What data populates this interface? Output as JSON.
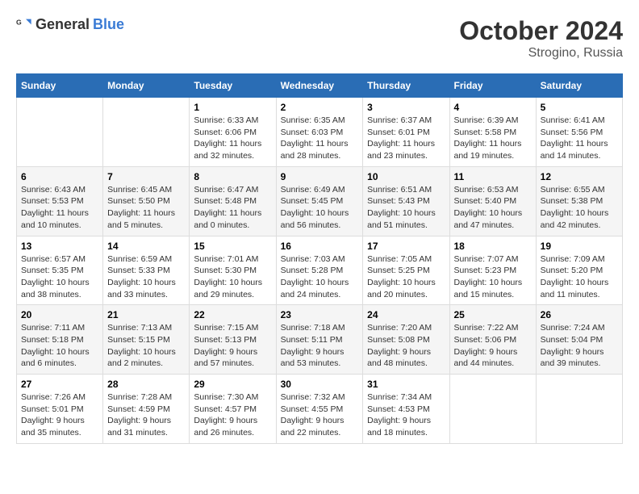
{
  "header": {
    "logo_general": "General",
    "logo_blue": "Blue",
    "month": "October 2024",
    "location": "Strogino, Russia"
  },
  "weekdays": [
    "Sunday",
    "Monday",
    "Tuesday",
    "Wednesday",
    "Thursday",
    "Friday",
    "Saturday"
  ],
  "weeks": [
    [
      null,
      null,
      {
        "day": 1,
        "sunrise": "6:33 AM",
        "sunset": "6:06 PM",
        "daylight": "11 hours and 32 minutes."
      },
      {
        "day": 2,
        "sunrise": "6:35 AM",
        "sunset": "6:03 PM",
        "daylight": "11 hours and 28 minutes."
      },
      {
        "day": 3,
        "sunrise": "6:37 AM",
        "sunset": "6:01 PM",
        "daylight": "11 hours and 23 minutes."
      },
      {
        "day": 4,
        "sunrise": "6:39 AM",
        "sunset": "5:58 PM",
        "daylight": "11 hours and 19 minutes."
      },
      {
        "day": 5,
        "sunrise": "6:41 AM",
        "sunset": "5:56 PM",
        "daylight": "11 hours and 14 minutes."
      }
    ],
    [
      {
        "day": 6,
        "sunrise": "6:43 AM",
        "sunset": "5:53 PM",
        "daylight": "11 hours and 10 minutes."
      },
      {
        "day": 7,
        "sunrise": "6:45 AM",
        "sunset": "5:50 PM",
        "daylight": "11 hours and 5 minutes."
      },
      {
        "day": 8,
        "sunrise": "6:47 AM",
        "sunset": "5:48 PM",
        "daylight": "11 hours and 0 minutes."
      },
      {
        "day": 9,
        "sunrise": "6:49 AM",
        "sunset": "5:45 PM",
        "daylight": "10 hours and 56 minutes."
      },
      {
        "day": 10,
        "sunrise": "6:51 AM",
        "sunset": "5:43 PM",
        "daylight": "10 hours and 51 minutes."
      },
      {
        "day": 11,
        "sunrise": "6:53 AM",
        "sunset": "5:40 PM",
        "daylight": "10 hours and 47 minutes."
      },
      {
        "day": 12,
        "sunrise": "6:55 AM",
        "sunset": "5:38 PM",
        "daylight": "10 hours and 42 minutes."
      }
    ],
    [
      {
        "day": 13,
        "sunrise": "6:57 AM",
        "sunset": "5:35 PM",
        "daylight": "10 hours and 38 minutes."
      },
      {
        "day": 14,
        "sunrise": "6:59 AM",
        "sunset": "5:33 PM",
        "daylight": "10 hours and 33 minutes."
      },
      {
        "day": 15,
        "sunrise": "7:01 AM",
        "sunset": "5:30 PM",
        "daylight": "10 hours and 29 minutes."
      },
      {
        "day": 16,
        "sunrise": "7:03 AM",
        "sunset": "5:28 PM",
        "daylight": "10 hours and 24 minutes."
      },
      {
        "day": 17,
        "sunrise": "7:05 AM",
        "sunset": "5:25 PM",
        "daylight": "10 hours and 20 minutes."
      },
      {
        "day": 18,
        "sunrise": "7:07 AM",
        "sunset": "5:23 PM",
        "daylight": "10 hours and 15 minutes."
      },
      {
        "day": 19,
        "sunrise": "7:09 AM",
        "sunset": "5:20 PM",
        "daylight": "10 hours and 11 minutes."
      }
    ],
    [
      {
        "day": 20,
        "sunrise": "7:11 AM",
        "sunset": "5:18 PM",
        "daylight": "10 hours and 6 minutes."
      },
      {
        "day": 21,
        "sunrise": "7:13 AM",
        "sunset": "5:15 PM",
        "daylight": "10 hours and 2 minutes."
      },
      {
        "day": 22,
        "sunrise": "7:15 AM",
        "sunset": "5:13 PM",
        "daylight": "9 hours and 57 minutes."
      },
      {
        "day": 23,
        "sunrise": "7:18 AM",
        "sunset": "5:11 PM",
        "daylight": "9 hours and 53 minutes."
      },
      {
        "day": 24,
        "sunrise": "7:20 AM",
        "sunset": "5:08 PM",
        "daylight": "9 hours and 48 minutes."
      },
      {
        "day": 25,
        "sunrise": "7:22 AM",
        "sunset": "5:06 PM",
        "daylight": "9 hours and 44 minutes."
      },
      {
        "day": 26,
        "sunrise": "7:24 AM",
        "sunset": "5:04 PM",
        "daylight": "9 hours and 39 minutes."
      }
    ],
    [
      {
        "day": 27,
        "sunrise": "7:26 AM",
        "sunset": "5:01 PM",
        "daylight": "9 hours and 35 minutes."
      },
      {
        "day": 28,
        "sunrise": "7:28 AM",
        "sunset": "4:59 PM",
        "daylight": "9 hours and 31 minutes."
      },
      {
        "day": 29,
        "sunrise": "7:30 AM",
        "sunset": "4:57 PM",
        "daylight": "9 hours and 26 minutes."
      },
      {
        "day": 30,
        "sunrise": "7:32 AM",
        "sunset": "4:55 PM",
        "daylight": "9 hours and 22 minutes."
      },
      {
        "day": 31,
        "sunrise": "7:34 AM",
        "sunset": "4:53 PM",
        "daylight": "9 hours and 18 minutes."
      },
      null,
      null
    ]
  ]
}
